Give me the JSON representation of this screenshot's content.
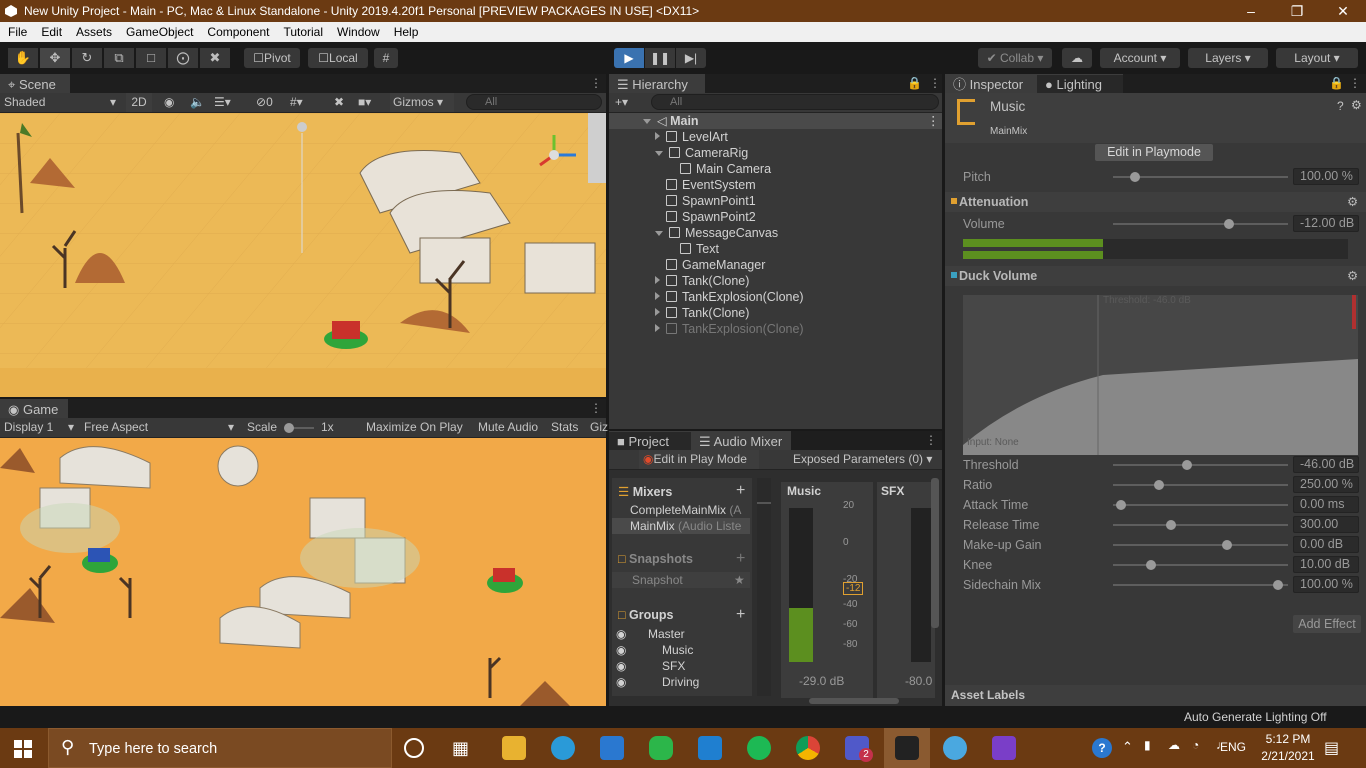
{
  "titlebar": {
    "title": "New Unity Project - Main - PC, Mac & Linux Standalone - Unity 2019.4.20f1 Personal [PREVIEW PACKAGES IN USE] <DX11>"
  },
  "menu": [
    "File",
    "Edit",
    "Assets",
    "GameObject",
    "Component",
    "Tutorial",
    "Window",
    "Help"
  ],
  "toolbar": {
    "pivot": "Pivot",
    "local": "Local",
    "collab": "Collab",
    "account": "Account",
    "layers": "Layers",
    "layout": "Layout"
  },
  "scene": {
    "tab": "Scene",
    "shading": "Shaded",
    "mode2d": "2D",
    "hidden_count": "0",
    "gizmos": "Gizmos",
    "search_placeholder": "All"
  },
  "game": {
    "tab": "Game",
    "display": "Display 1",
    "aspect": "Free Aspect",
    "scale_label": "Scale",
    "scale_value": "1x",
    "maximize": "Maximize On Play",
    "mute": "Mute Audio",
    "stats": "Stats",
    "gizmos": "Giz"
  },
  "hierarchy": {
    "tab": "Hierarchy",
    "search_placeholder": "All",
    "root": "Main",
    "items": [
      {
        "label": "LevelArt",
        "indent": 1,
        "expander": "collapsed"
      },
      {
        "label": "CameraRig",
        "indent": 1,
        "expander": "expanded"
      },
      {
        "label": "Main Camera",
        "indent": 2,
        "expander": "none"
      },
      {
        "label": "EventSystem",
        "indent": 1,
        "expander": "none"
      },
      {
        "label": "SpawnPoint1",
        "indent": 1,
        "expander": "none"
      },
      {
        "label": "SpawnPoint2",
        "indent": 1,
        "expander": "none"
      },
      {
        "label": "MessageCanvas",
        "indent": 1,
        "expander": "expanded"
      },
      {
        "label": "Text",
        "indent": 2,
        "expander": "none"
      },
      {
        "label": "GameManager",
        "indent": 1,
        "expander": "none"
      },
      {
        "label": "Tank(Clone)",
        "indent": 1,
        "expander": "collapsed"
      },
      {
        "label": "TankExplosion(Clone)",
        "indent": 1,
        "expander": "collapsed"
      },
      {
        "label": "Tank(Clone)",
        "indent": 1,
        "expander": "collapsed"
      },
      {
        "label": "TankExplosion(Clone)",
        "indent": 1,
        "expander": "collapsed",
        "disabled": true
      }
    ]
  },
  "mixer": {
    "tab_project": "Project",
    "tab_mixer": "Audio Mixer",
    "edit_play": "Edit in Play Mode",
    "exposed": "Exposed Parameters (0)",
    "mixers_header": "Mixers",
    "mixers": [
      {
        "name": "CompleteMainMix",
        "suffix": "(A"
      },
      {
        "name": "MainMix",
        "suffix": "(Audio Liste"
      }
    ],
    "snapshots_header": "Snapshots",
    "snapshot": "Snapshot",
    "groups_header": "Groups",
    "groups": [
      "Master",
      "Music",
      "SFX",
      "Driving"
    ],
    "strips": [
      {
        "name": "Music",
        "db": "-29.0 dB",
        "marker": "-12",
        "level": 0.35
      },
      {
        "name": "SFX",
        "db": "-80.0",
        "level": 0.0
      }
    ],
    "scale": [
      "20",
      "0",
      "-20",
      "-40",
      "-60",
      "-80"
    ],
    "left_scale": [
      "0",
      "0",
      "0",
      "0",
      "0"
    ]
  },
  "inspector": {
    "tab": "Inspector",
    "lighting_tab": "Lighting",
    "title": "Music",
    "subtitle": "MainMix",
    "edit_playmode": "Edit in Playmode",
    "pitch": {
      "label": "Pitch",
      "value": "100.00 %",
      "pos": 0.1
    },
    "attenuation": {
      "header": "Attenuation",
      "label": "Volume",
      "value": "-12.00 dB",
      "pos": 0.67
    },
    "duck": {
      "header": "Duck Volume",
      "graph_threshold": "Threshold: -46.0 dB",
      "graph_input": "Input: None"
    },
    "params": [
      {
        "label": "Threshold",
        "value": "-46.00 dB",
        "pos": 0.42
      },
      {
        "label": "Ratio",
        "value": "250.00 %",
        "pos": 0.25
      },
      {
        "label": "Attack Time",
        "value": "0.00 ms",
        "pos": 0.02
      },
      {
        "label": "Release Time",
        "value": "300.00 ms",
        "pos": 0.32
      },
      {
        "label": "Make-up Gain",
        "value": "0.00 dB",
        "pos": 0.66
      },
      {
        "label": "Knee",
        "value": "10.00 dB",
        "pos": 0.2
      },
      {
        "label": "Sidechain Mix",
        "value": "100.00 %",
        "pos": 0.97
      }
    ],
    "add_effect": "Add Effect",
    "asset_labels": "Asset Labels"
  },
  "status": {
    "text": "Auto Generate Lighting Off"
  },
  "taskbar": {
    "search_placeholder": "Type here to search",
    "time": "5:12 PM",
    "date": "2/21/2021",
    "lang": "ENG",
    "teams_badge": "2"
  },
  "colors": {
    "accent": "#3a72b0",
    "titlebar": "#6b3a12",
    "meter": "#5c8f1f"
  }
}
